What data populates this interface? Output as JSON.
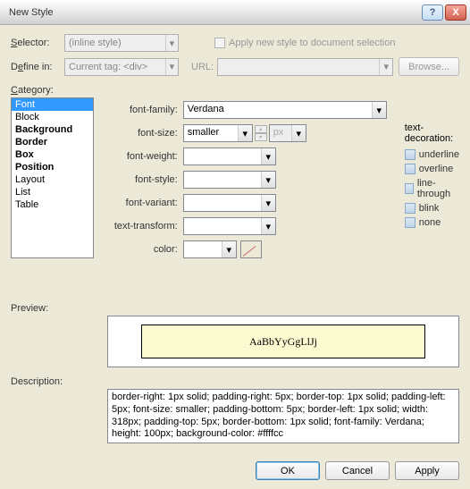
{
  "title": "New Style",
  "selector": {
    "label_html": "Selector:",
    "value": "(inline style)"
  },
  "define": {
    "label_html": "Define in:",
    "value": "Current tag: <div>"
  },
  "apply_chk": "Apply new style to document selection",
  "url_label": "URL:",
  "browse_label": "Browse...",
  "category_label": "Category:",
  "categories": [
    {
      "name": "Font",
      "bold": true,
      "selected": true
    },
    {
      "name": "Block",
      "bold": false
    },
    {
      "name": "Background",
      "bold": true
    },
    {
      "name": "Border",
      "bold": true
    },
    {
      "name": "Box",
      "bold": true
    },
    {
      "name": "Position",
      "bold": true
    },
    {
      "name": "Layout",
      "bold": false
    },
    {
      "name": "List",
      "bold": false
    },
    {
      "name": "Table",
      "bold": false
    }
  ],
  "props": {
    "font_family": {
      "label": "font-family:",
      "value": "Verdana"
    },
    "font_size": {
      "label": "font-size:",
      "value": "smaller",
      "unit": "px"
    },
    "font_weight": {
      "label": "font-weight:",
      "value": ""
    },
    "font_style": {
      "label": "font-style:",
      "value": ""
    },
    "font_variant": {
      "label": "font-variant:",
      "value": ""
    },
    "text_transform": {
      "label": "text-transform:",
      "value": ""
    },
    "color": {
      "label": "color:",
      "value": ""
    }
  },
  "decor": {
    "title": "text-decoration:",
    "items": [
      "underline",
      "overline",
      "line-through",
      "blink",
      "none"
    ]
  },
  "preview_label": "Preview:",
  "preview_text": "AaBbYyGgLlJj",
  "description_label": "Description:",
  "description_text": "border-right: 1px solid; padding-right: 5px; border-top: 1px solid; padding-left: 5px; font-size: smaller; padding-bottom: 5px; border-left: 1px solid; width: 318px; padding-top: 5px; border-bottom: 1px solid; font-family: Verdana; height: 100px; background-color: #ffffcc",
  "buttons": {
    "ok": "OK",
    "cancel": "Cancel",
    "apply": "Apply"
  }
}
